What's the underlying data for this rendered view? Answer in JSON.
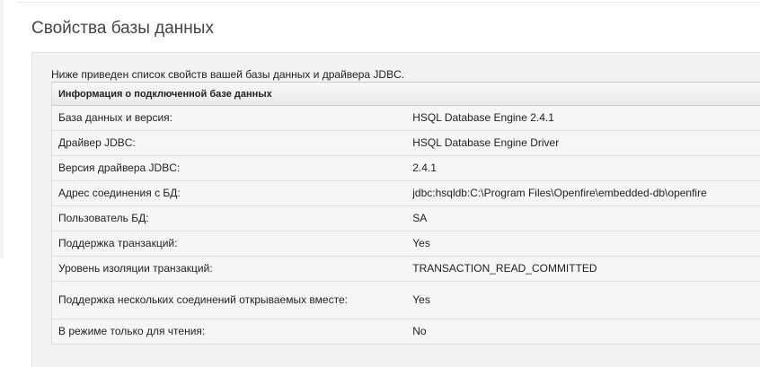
{
  "page": {
    "title": "Свойства базы данных",
    "intro": "Ниже приведен список свойств вашей базы данных и драйвера JDBC."
  },
  "table": {
    "header": "Информация о подключенной базе данных",
    "rows": [
      {
        "label": "База данных и версия:",
        "value": "HSQL Database Engine 2.4.1"
      },
      {
        "label": "Драйвер JDBC:",
        "value": "HSQL Database Engine Driver"
      },
      {
        "label": "Версия драйвера JDBC:",
        "value": "2.4.1"
      },
      {
        "label": "Адрес соединения с БД:",
        "value": "jdbc:hsqldb:C:\\Program Files\\Openfire\\embedded-db\\openfire"
      },
      {
        "label": "Пользователь БД:",
        "value": "SA"
      },
      {
        "label": "Поддержка транзакций:",
        "value": "Yes"
      },
      {
        "label": "Уровень изоляции транзакций:",
        "value": "TRANSACTION_READ_COMMITTED"
      },
      {
        "label": "Поддержка нескольких соединений открываемых вместе:",
        "value": "Yes"
      },
      {
        "label": "В режиме только для чтения:",
        "value": "No"
      }
    ]
  }
}
